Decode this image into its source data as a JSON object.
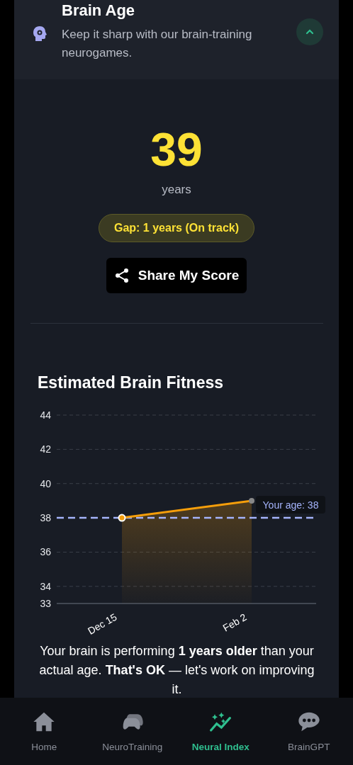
{
  "header": {
    "title": "Brain Age",
    "description": "Keep it sharp with our brain-training neurogames.",
    "expanded": true
  },
  "score": {
    "value": "39",
    "unit": "years",
    "gap": "Gap: 1 years (On track)",
    "share_button": "Share My Score"
  },
  "chart_section": {
    "title": "Estimated Brain Fitness",
    "chart_data": {
      "type": "area",
      "categories": [
        "Dec 15",
        "Feb 2"
      ],
      "series": [
        {
          "color": "#f59e0b",
          "values": [
            38,
            39
          ]
        }
      ],
      "ylim": [
        33,
        44
      ],
      "yticks": [
        33,
        34,
        36,
        38,
        40,
        42,
        44
      ],
      "grid": true,
      "ref_lines": [
        {
          "axis": "y",
          "value": 38,
          "label": "Your age: 38",
          "color": "#a5b4fc"
        }
      ]
    },
    "summary": "Your brain is performing **1 years older** than your actual age. **That's OK** — let's work on improving it."
  },
  "nav": [
    {
      "label": "Home",
      "selected": false
    },
    {
      "label": "NeuroTraining",
      "selected": false
    },
    {
      "label": "Neural Index",
      "selected": true
    },
    {
      "label": "BrainGPT",
      "selected": false
    }
  ]
}
